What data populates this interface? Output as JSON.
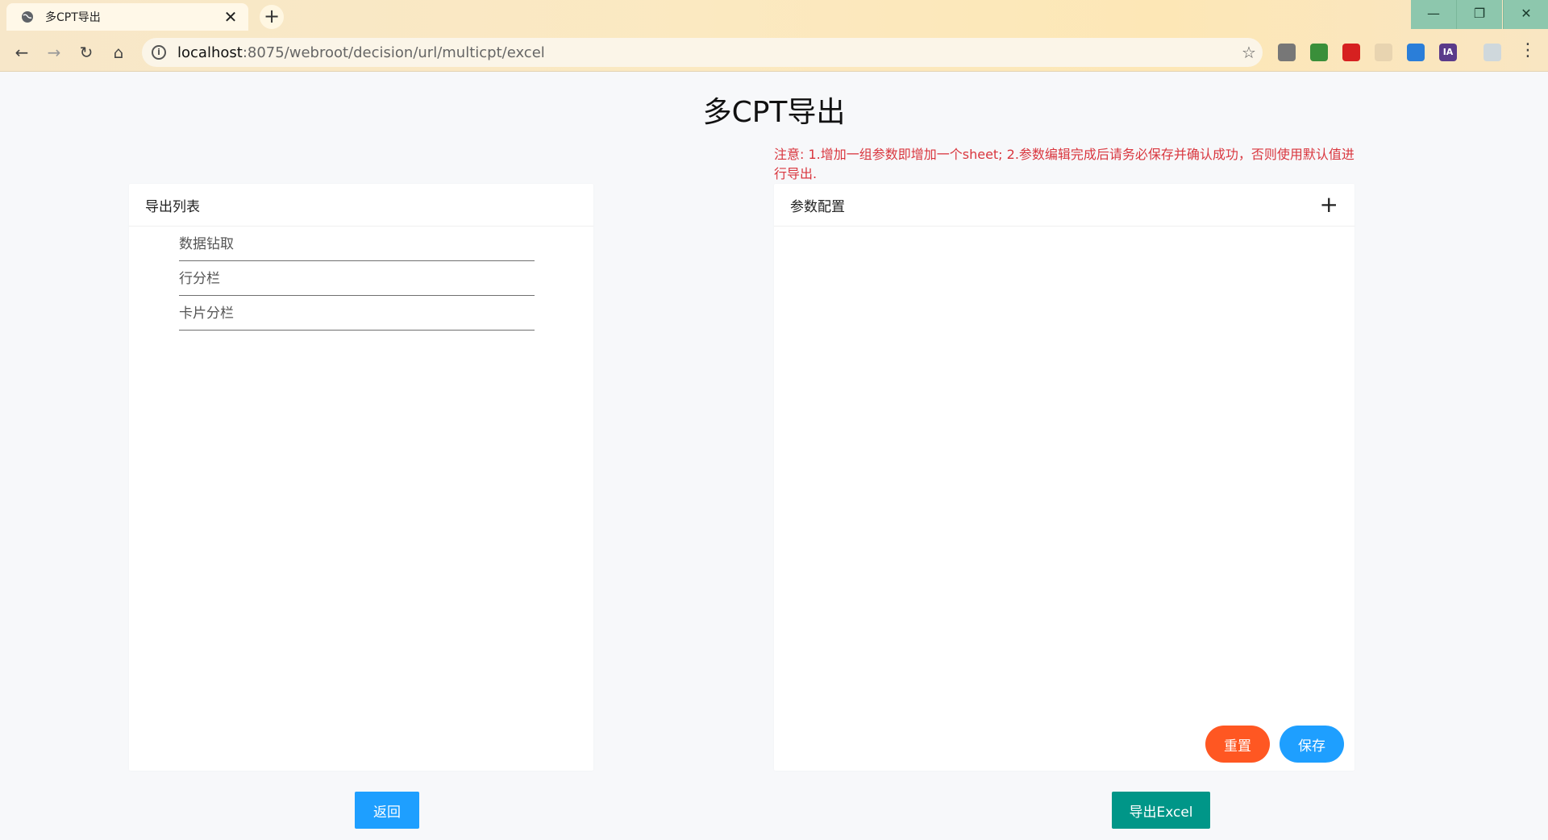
{
  "browser": {
    "tab_title": "多CPT导出",
    "tab_close": "✕",
    "new_tab": "+",
    "url_host": "localhost",
    "url_rest": ":8075/webroot/decision/url/multicpt/excel",
    "window_controls": {
      "minimize": "—",
      "restore": "❐",
      "close": "✕"
    },
    "nav": {
      "back": "←",
      "forward": "→",
      "reload": "↻",
      "home": "⌂"
    },
    "extensions": [
      {
        "name": "extension-1",
        "label": "",
        "color": "#777777"
      },
      {
        "name": "extension-2",
        "label": "",
        "color": "#3a8f3a"
      },
      {
        "name": "extension-3",
        "label": "",
        "color": "#d62020"
      },
      {
        "name": "extension-4",
        "label": "",
        "color": "#e8d4b0"
      },
      {
        "name": "extension-5",
        "label": "",
        "color": "#2a7ed9"
      },
      {
        "name": "extension-6",
        "label": "IA",
        "color": "#5a3a8a"
      },
      {
        "name": "extension-7",
        "label": "",
        "color": "#cfd8dc"
      }
    ]
  },
  "page": {
    "title": "多CPT导出",
    "notice": "注意: 1.增加一组参数即增加一个sheet; 2.参数编辑完成后请务必保存并确认成功，否则使用默认值进行导出.",
    "export_list": {
      "header": "导出列表",
      "items": [
        "数据钻取",
        "行分栏",
        "卡片分栏"
      ]
    },
    "params": {
      "header": "参数配置",
      "add_icon": "+",
      "reset_label": "重置",
      "save_label": "保存"
    },
    "back_label": "返回",
    "export_label": "导出Excel"
  }
}
